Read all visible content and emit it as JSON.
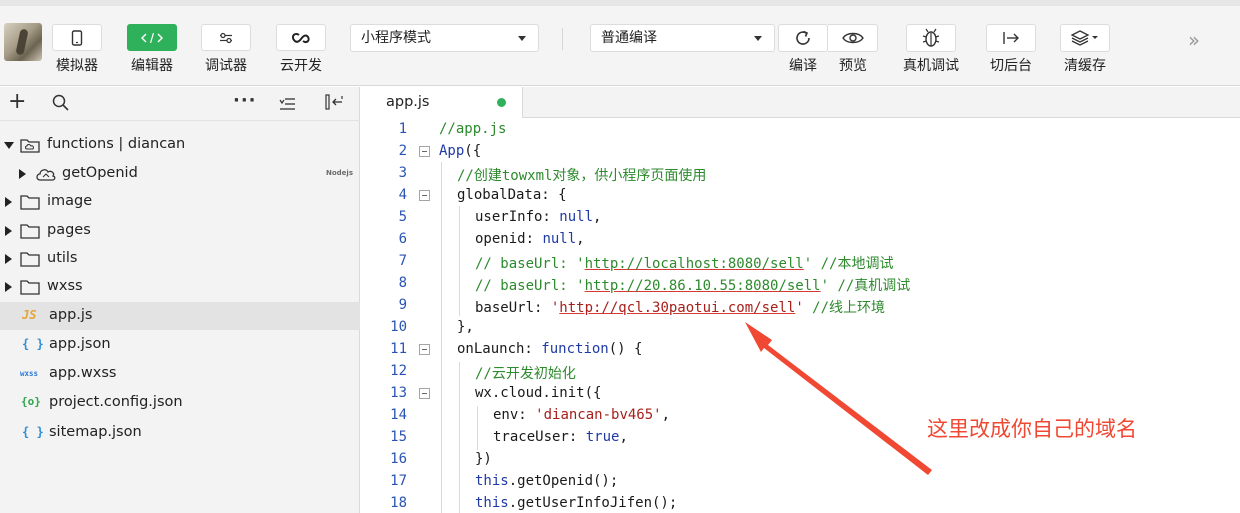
{
  "colors": {
    "accent_green": "#2fb05a",
    "annotation_red": "#f04832",
    "comment_green": "#2d8a2d",
    "string_red": "#a6201b",
    "keyword_blue": "#1f3aa5"
  },
  "toolbar": {
    "simulator_label": "模拟器",
    "editor_label": "编辑器",
    "debugger_label": "调试器",
    "cloud_label": "云开发",
    "mode_select": "小程序模式",
    "compile_select": "普通编译",
    "compile_label": "编译",
    "preview_label": "预览",
    "remote_debug_label": "真机调试",
    "background_label": "切后台",
    "clear_cache_label": "清缓存"
  },
  "sidebar": {
    "tree": [
      {
        "name": "functions | diancan",
        "icon": "cloud-folder-icon"
      },
      {
        "name": "getOpenid",
        "icon": "cloud-icon",
        "tag": "Nodejs"
      },
      {
        "name": "image",
        "icon": "folder-icon"
      },
      {
        "name": "pages",
        "icon": "folder-icon"
      },
      {
        "name": "utils",
        "icon": "folder-icon"
      },
      {
        "name": "wxss",
        "icon": "folder-icon"
      },
      {
        "name": "app.js",
        "icon": "js-file-icon",
        "type": "JS"
      },
      {
        "name": "app.json",
        "icon": "json-file-icon",
        "type": "{ }"
      },
      {
        "name": "app.wxss",
        "icon": "wxss-file-icon",
        "type": "wxss"
      },
      {
        "name": "project.config.json",
        "icon": "config-file-icon",
        "type": "{o}"
      },
      {
        "name": "sitemap.json",
        "icon": "json-file-icon",
        "type": "{ }"
      }
    ]
  },
  "editor": {
    "tab": "app.js",
    "line_numbers": [
      "1",
      "2",
      "3",
      "4",
      "5",
      "6",
      "7",
      "8",
      "9",
      "10",
      "11",
      "12",
      "13",
      "14",
      "15",
      "16",
      "17",
      "18"
    ],
    "lines": {
      "l1": "//app.js",
      "l2a": "App",
      "l2b": "({",
      "l3": "//创建towxml对象，供小程序页面使用",
      "l4": "globalData: {",
      "l5a": "userInfo: ",
      "l5b": "null",
      "l5c": ",",
      "l6a": "openid: ",
      "l6b": "null",
      "l6c": ",",
      "l7a": "// baseUrl: '",
      "l7b": "http://localhost:8080/sell",
      "l7c": "' //本地调试",
      "l8a": "// baseUrl: '",
      "l8b": "http://20.86.10.55:8080/sell",
      "l8c": "' //真机调试",
      "l9a": "baseUrl: ",
      "l9b": "'",
      "l9c": "http://qcl.30paotui.com/sell",
      "l9d": "'",
      "l9e": " //线上环境",
      "l10": "},",
      "l11a": "onLaunch: ",
      "l11b": "function",
      "l11c": "() {",
      "l12": "//云开发初始化",
      "l13": "wx.cloud.init({",
      "l14a": "env: ",
      "l14b": "'diancan-bv465'",
      "l14c": ",",
      "l15a": "traceUser: ",
      "l15b": "true",
      "l15c": ",",
      "l16": "})",
      "l17a": "this",
      "l17b": ".getOpenid();",
      "l18a": "this",
      "l18b": ".getUserInfoJifen();"
    }
  },
  "annotation": {
    "text": "这里改成你自己的域名"
  }
}
